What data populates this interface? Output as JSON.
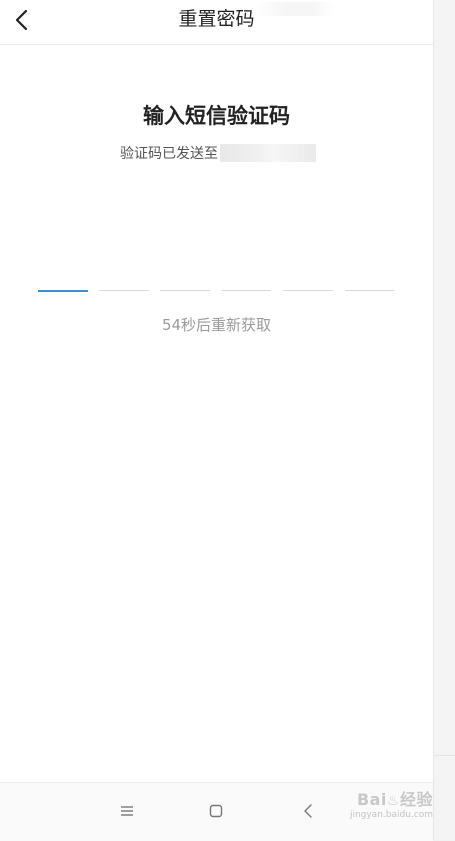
{
  "header": {
    "title": "重置密码"
  },
  "main": {
    "heading": "输入短信验证码",
    "sent_to_label": "验证码已发送至",
    "code_slots": 6,
    "countdown_text": "54秒后重新获取"
  },
  "navbar": {
    "items": [
      "menu",
      "home",
      "back"
    ]
  },
  "watermark": {
    "logo": "Baidu 经验",
    "url": "jingyan.baidu.com"
  },
  "colors": {
    "accent": "#3f8fd2",
    "slot_inactive": "#d9d9d9",
    "muted_text": "#9a9a9a"
  }
}
